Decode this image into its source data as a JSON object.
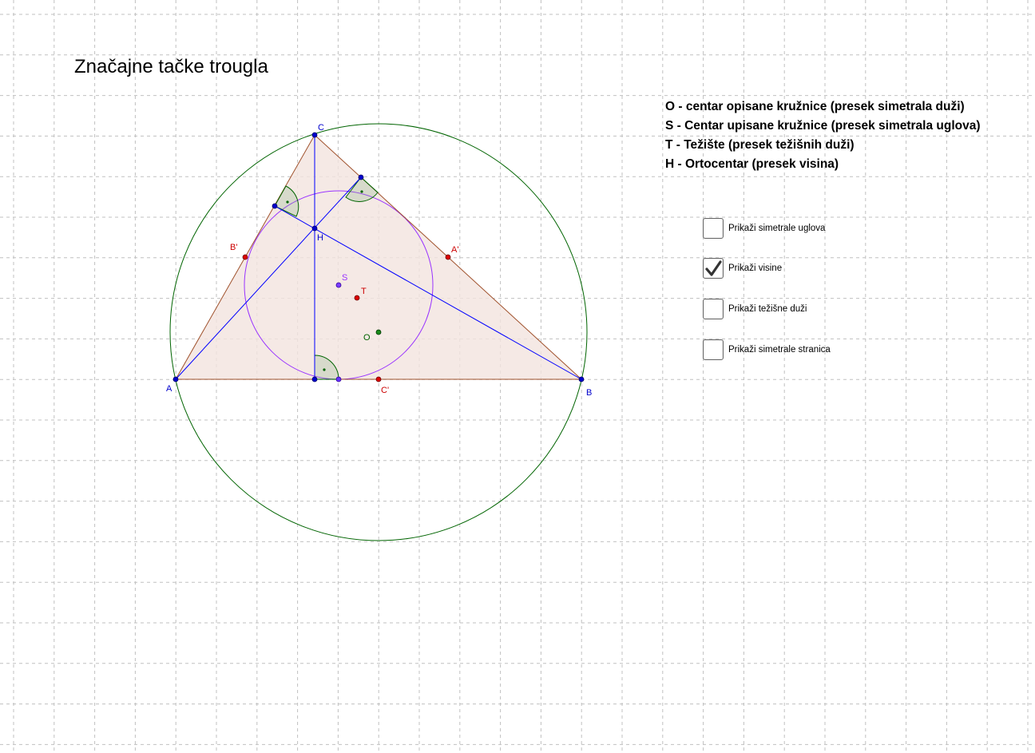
{
  "title": "Značajne tačke trougla",
  "legend": [
    "O - centar opisane kružnice (presek simetrala duži)",
    "S - Centar upisane kružnice (presek simetrala uglova)",
    "T - Težište (presek težišnih duži)",
    "H - Ortocentar (presek visina)"
  ],
  "checkboxes": [
    {
      "label": "Prikaži simetrale uglova",
      "checked": false
    },
    {
      "label": "Prikaži visine",
      "checked": true
    },
    {
      "label": "Prikaži težišne duži",
      "checked": false
    },
    {
      "label": "Prikaži simetrale stranica",
      "checked": false
    }
  ],
  "points": {
    "A": "A",
    "B": "B",
    "C": "C",
    "A_prime": "A'",
    "B_prime": "B'",
    "C_prime": "C'",
    "H": "H",
    "S": "S",
    "T": "T",
    "O": "O"
  },
  "colors": {
    "vertex": "#0000cc",
    "midpoint": "#cc0000",
    "circumcircle": "#006400",
    "incircle": "#9933ff",
    "altitude": "#0000ff",
    "triangle_edge": "#a0522d",
    "triangle_fill": "#f3e4df",
    "grid": "#c0c0c0"
  }
}
